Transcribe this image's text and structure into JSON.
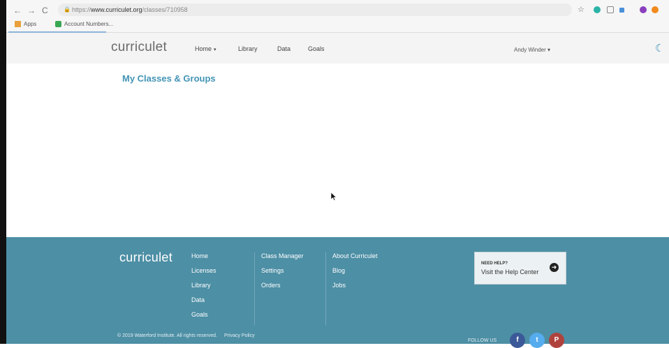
{
  "browser": {
    "back": "←",
    "forward": "→",
    "reload": "C",
    "url_scheme": "https://",
    "url_host": "www.curriculet.org",
    "url_path": "/classes/710958",
    "bookmarks": [
      {
        "label": "Apps"
      },
      {
        "label": "Account Numbers..."
      }
    ]
  },
  "header": {
    "logo": "curriculet",
    "nav": [
      {
        "label": "Home",
        "has_dropdown": true
      },
      {
        "label": "Library"
      },
      {
        "label": "Data"
      },
      {
        "label": "Goals"
      }
    ],
    "user": "Andy Winder"
  },
  "main": {
    "title": "My Classes & Groups"
  },
  "footer": {
    "logo": "curriculet",
    "col1": [
      "Home",
      "Licenses",
      "Library",
      "Data",
      "Goals"
    ],
    "col2": [
      "Class Manager",
      "Settings",
      "Orders"
    ],
    "col3": [
      "About Curriculet",
      "Blog",
      "Jobs"
    ],
    "help": {
      "need": "NEED HELP?",
      "visit": "Visit the Help Center"
    },
    "copyright": "© 2019 Waterford Institute. All rights reserved.",
    "privacy": "Privacy Policy",
    "follow": "FOLLOW US"
  },
  "colors": {
    "accent": "#4294b5",
    "footer_bg": "#4d8fa5",
    "header_bg": "#f4f4f4"
  }
}
